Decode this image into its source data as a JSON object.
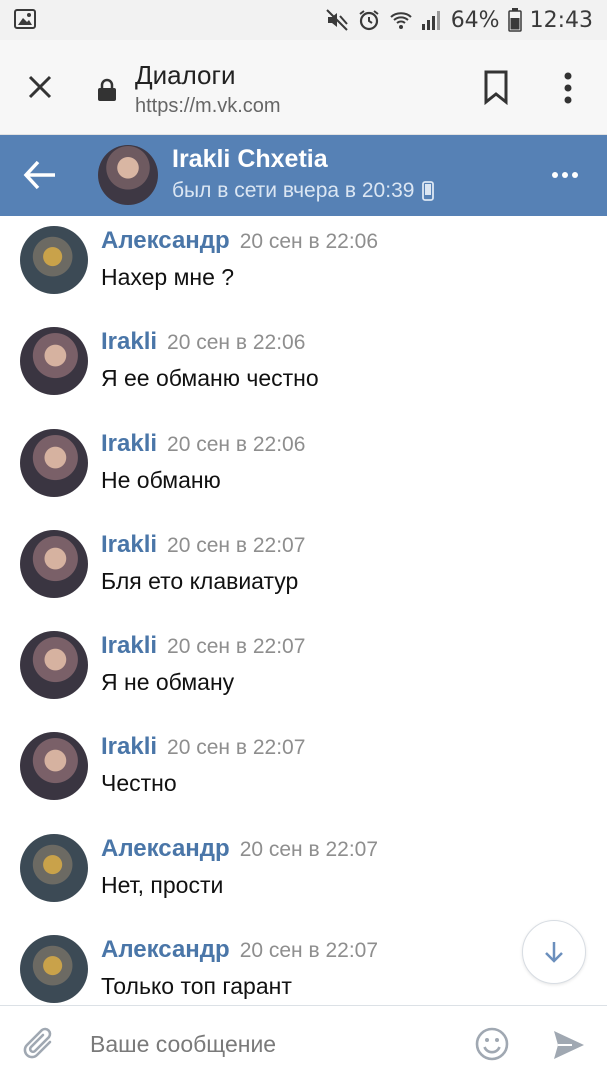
{
  "status_bar": {
    "battery": "64%",
    "time": "12:43",
    "icons": [
      "gallery-icon",
      "mute-icon",
      "alarm-icon",
      "wifi-icon",
      "signal-icon",
      "battery-icon"
    ]
  },
  "browser": {
    "title": "Диалоги",
    "url": "https://m.vk.com",
    "icons": [
      "close-icon",
      "lock-icon",
      "bookmark-icon",
      "kebab-menu-icon"
    ]
  },
  "header": {
    "name": "Irakli Chxetia",
    "status": "был в сети вчера в 20:39",
    "icons": [
      "back-arrow-icon",
      "mobile-phone-icon",
      "more-icon"
    ]
  },
  "messages": [
    {
      "author": "Александр",
      "time": "20 сен в 22:06",
      "text": "Нахер мне ?",
      "avatar": "alex"
    },
    {
      "author": "Irakli",
      "time": "20 сен в 22:06",
      "text": "Я ее обманю честно",
      "avatar": "irakli"
    },
    {
      "author": "Irakli",
      "time": "20 сен в 22:06",
      "text": "Не обманю",
      "avatar": "irakli"
    },
    {
      "author": "Irakli",
      "time": "20 сен в 22:07",
      "text": "Бля ето клавиатур",
      "avatar": "irakli"
    },
    {
      "author": "Irakli",
      "time": "20 сен в 22:07",
      "text": "Я не обману",
      "avatar": "irakli"
    },
    {
      "author": "Irakli",
      "time": "20 сен в 22:07",
      "text": "Честно",
      "avatar": "irakli"
    },
    {
      "author": "Александр",
      "time": "20 сен в 22:07",
      "text": "Нет, прости",
      "avatar": "alex"
    },
    {
      "author": "Александр",
      "time": "20 сен в 22:07",
      "text": "Только топ гарант",
      "avatar": "alex"
    }
  ],
  "composer": {
    "placeholder": "Ваше сообщение",
    "icons": [
      "attach-icon",
      "emoji-icon",
      "send-icon"
    ]
  },
  "colors": {
    "header_bg": "#5681b5",
    "author": "#4a76a8",
    "time": "#8e8e8e"
  }
}
